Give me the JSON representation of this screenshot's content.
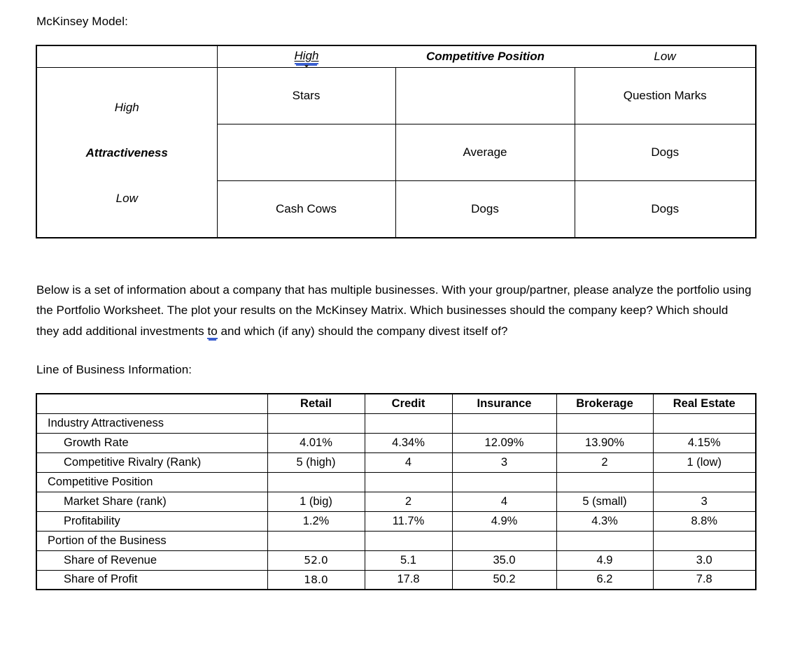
{
  "document": {
    "title_mckinsey": "McKinsey Model:",
    "label_line_of_business": "Line of Business Information:",
    "paragraph": {
      "part1": "Below is a set of information about a company that has multiple businesses.  With your group/partner, please analyze the portfolio using the Portfolio Worksheet.  The plot your results on the McKinsey Matrix.  Which businesses should the company keep?  Which should they add additional investments ",
      "flagged_word": "to",
      "part2": " and which (if any) should the company divest itself of?"
    }
  },
  "matrix": {
    "header": {
      "corner": "",
      "high": "High",
      "center_title": "Competitive Position",
      "low": "Low"
    },
    "axis_title": {
      "top": "High",
      "middle": "Attractiveness",
      "bottom": "Low"
    },
    "rows": [
      {
        "cells": [
          "Stars",
          "",
          "Question Marks"
        ]
      },
      {
        "cells": [
          "",
          "Average",
          "Dogs"
        ]
      },
      {
        "cells": [
          "Cash Cows",
          "Dogs",
          "Dogs"
        ]
      }
    ]
  },
  "lob_table": {
    "columns": [
      "",
      "Retail",
      "Credit",
      "Insurance",
      "Brokerage",
      "Real Estate"
    ],
    "rows": [
      {
        "label": "Industry Attractiveness",
        "level": 0,
        "values": [
          "",
          "",
          "",
          "",
          ""
        ]
      },
      {
        "label": "Growth Rate",
        "level": 1,
        "values": [
          "4.01%",
          "4.34%",
          "12.09%",
          "13.90%",
          "4.15%"
        ]
      },
      {
        "label": "Competitive Rivalry (Rank)",
        "level": 1,
        "values": [
          "5 (high)",
          "4",
          "3",
          "2",
          "1 (low)"
        ]
      },
      {
        "label": "Competitive Position",
        "level": 0,
        "values": [
          "",
          "",
          "",
          "",
          ""
        ]
      },
      {
        "label": "Market Share (rank)",
        "level": 1,
        "values": [
          "1 (big)",
          "2",
          "4",
          "5 (small)",
          "3"
        ]
      },
      {
        "label": "Profitability",
        "level": 1,
        "values": [
          "1.2%",
          "11.7%",
          "4.9%",
          "4.3%",
          "8.8%"
        ]
      },
      {
        "label": "Portion of the Business",
        "level": 0,
        "values": [
          "",
          "",
          "",
          "",
          ""
        ]
      },
      {
        "label": "Share of Revenue",
        "level": 1,
        "values": [
          "52.0",
          "5.1",
          "35.0",
          "4.9",
          "3.0"
        ]
      },
      {
        "label": "Share of Profit",
        "level": 1,
        "values": [
          "18.0",
          "17.8",
          "50.2",
          "6.2",
          "7.8"
        ]
      }
    ]
  },
  "colors": {
    "grammar_underline": "#3b5fd0",
    "border": "#000000",
    "text": "#000000"
  }
}
